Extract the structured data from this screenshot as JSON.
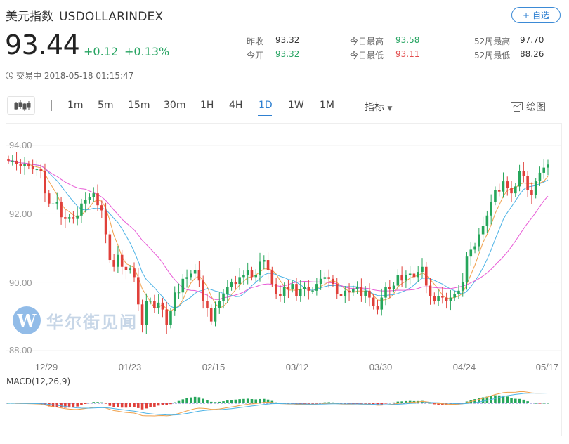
{
  "header": {
    "name_cn": "美元指数",
    "code": "USDOLLARINDEX",
    "follow_label": "自选",
    "price": "93.44",
    "change": "+0.12",
    "change_pct": "+0.13%",
    "status": "交易中 2018-05-18 01:15:47"
  },
  "stats": [
    {
      "label": "昨收",
      "value": "93.32",
      "color": "#333333"
    },
    {
      "label": "今开",
      "value": "93.32",
      "color": "#27a462"
    },
    {
      "label": "今日最高",
      "value": "93.58",
      "color": "#27a462"
    },
    {
      "label": "今日最低",
      "value": "93.11",
      "color": "#e24a4a"
    },
    {
      "label": "52周最高",
      "value": "97.70",
      "color": "#333333"
    },
    {
      "label": "52周最低",
      "value": "88.26",
      "color": "#333333"
    }
  ],
  "toolbar": {
    "timeframes": [
      "1m",
      "5m",
      "15m",
      "30m",
      "1H",
      "4H",
      "1D",
      "1W",
      "1M"
    ],
    "active_timeframe": "1D",
    "indicator_label": "指标",
    "draw_label": "绘图"
  },
  "watermark": {
    "logo_letter": "W",
    "text": "华尔街见闻"
  },
  "colors": {
    "up": "#26a65b",
    "down": "#e0403a",
    "ma5": "#f0a04b",
    "ma10": "#4db3e6",
    "ma20": "#e85bd6",
    "accent": "#2f80d1"
  },
  "chart_data": {
    "type": "candlestick",
    "y_ticks": [
      "94.00",
      "92.00",
      "90.00",
      "88.00"
    ],
    "ylim": [
      88.0,
      94.0
    ],
    "x_ticks": [
      "12/29",
      "01/23",
      "02/15",
      "03/12",
      "03/30",
      "04/24",
      "05/17"
    ],
    "macd_label": "MACD(12,26,9)",
    "close": [
      93.55,
      93.55,
      93.45,
      93.4,
      93.45,
      93.4,
      93.3,
      93.3,
      93.25,
      92.6,
      92.3,
      92.3,
      92.35,
      91.9,
      91.85,
      91.9,
      91.85,
      91.95,
      92.3,
      92.4,
      92.5,
      92.6,
      92.25,
      92.1,
      91.4,
      90.65,
      90.45,
      90.8,
      90.45,
      90.35,
      90.4,
      90.15,
      89.35,
      88.75,
      89.45,
      89.45,
      89.25,
      89.4,
      89.2,
      88.75,
      89.15,
      89.7,
      89.7,
      90.1,
      90.15,
      90.25,
      90.35,
      90.05,
      89.45,
      89.25,
      88.85,
      89.25,
      89.45,
      89.65,
      89.85,
      90.0,
      89.95,
      90.15,
      90.2,
      90.35,
      90.15,
      90.2,
      90.6,
      90.65,
      90.35,
      89.95,
      89.65,
      89.6,
      89.85,
      89.8,
      89.95,
      89.6,
      89.8,
      89.85,
      89.75,
      89.75,
      89.95,
      90.1,
      90.15,
      90.1,
      89.95,
      89.65,
      89.6,
      89.75,
      89.7,
      89.8,
      89.85,
      89.6,
      89.75,
      89.55,
      89.3,
      89.2,
      89.55,
      89.85,
      89.8,
      89.9,
      90.2,
      90.05,
      90.2,
      90.25,
      90.15,
      90.3,
      90.45,
      89.9,
      89.6,
      89.45,
      89.6,
      89.55,
      89.45,
      89.55,
      89.65,
      89.75,
      90.0,
      90.75,
      90.95,
      91.05,
      91.4,
      91.65,
      91.95,
      92.35,
      92.7,
      92.65,
      92.95,
      92.75,
      92.6,
      92.8,
      93.25,
      93.1,
      92.7,
      92.55,
      92.95,
      93.2,
      93.35,
      93.44
    ]
  }
}
